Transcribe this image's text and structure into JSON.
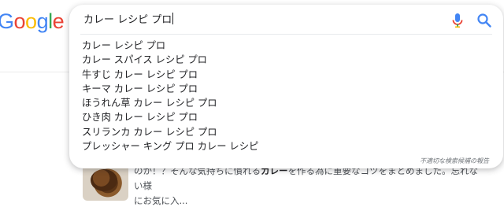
{
  "logo": {
    "letters": [
      "o",
      "o",
      "g",
      "l",
      "e"
    ],
    "colors": [
      "#ea4335",
      "#fbbc05",
      "#4285f4",
      "#34a853",
      "#ea4335"
    ],
    "partial_letter": "G",
    "partial_color": "#4285f4"
  },
  "search": {
    "query": "カレー レシピ プロ",
    "suggestions": [
      "カレー レシピ プロ",
      "カレー スパイス レシピ プロ",
      "牛すじ カレー レシピ プロ",
      "キーマ カレー レシピ プロ",
      "ほうれん草 カレー レシピ プロ",
      "ひき肉 カレー レシピ プロ",
      "スリランカ カレー レシピ プロ",
      "プレッシャー キング プロ カレー レシピ"
    ],
    "report_label": "不適切な検索候補の報告"
  },
  "icons": {
    "mic": "microphone-icon",
    "search": "search-icon"
  },
  "result": {
    "snippet_pre": "のか！？そんな気持ちに慣れる",
    "snippet_bold": "カレー",
    "snippet_post": "を作る為に重要なコツをまとめました。忘れない様",
    "snippet_line2": "にお気に入..."
  }
}
